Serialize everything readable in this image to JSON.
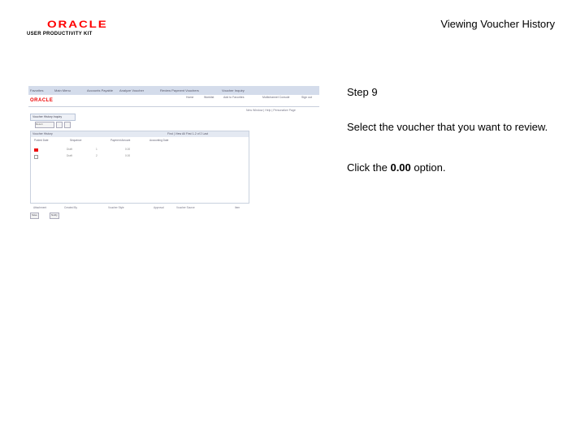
{
  "header": {
    "logo_word": "ORACLE",
    "logo_sub": "USER PRODUCTIVITY KIT",
    "title": "Viewing Voucher History"
  },
  "screenshot": {
    "brand": "ORACLE",
    "nav": [
      "Favorites",
      "Main Menu",
      "Accounts Payable",
      "Analyze Voucher",
      "Review Payment Vouchers",
      "Voucher Inquiry"
    ],
    "menu": [
      "Home",
      "Worklist",
      "Add to Favorites",
      "Multichannel Console",
      "Sign out"
    ],
    "links": "New Window | Help | Personalize Page",
    "tab": "Voucher History Inquiry",
    "buttons": [
      "Return",
      "",
      ""
    ],
    "panel_title": "Voucher History",
    "panel_nav": "Find | View All  First 1-2 of 2 Last",
    "columns": [
      "Posted Date",
      "Sequence",
      "Payment Amount",
      "Accounting Date"
    ],
    "rows": [
      {
        "a": "Draft",
        "b": "1",
        "c": "0.00"
      },
      {
        "a": "Draft",
        "b": "2",
        "c": "0.00"
      }
    ],
    "footer": [
      "Attachment",
      "Created By",
      "Voucher Style",
      "Approval",
      "Voucher Source",
      "Item"
    ],
    "save_buttons": [
      "Save",
      "Notify"
    ]
  },
  "instructions": {
    "step": "Step 9",
    "text": "Select the voucher that you want to review.",
    "action_prefix": "Click the ",
    "action_value": "0.00",
    "action_suffix": " option."
  }
}
